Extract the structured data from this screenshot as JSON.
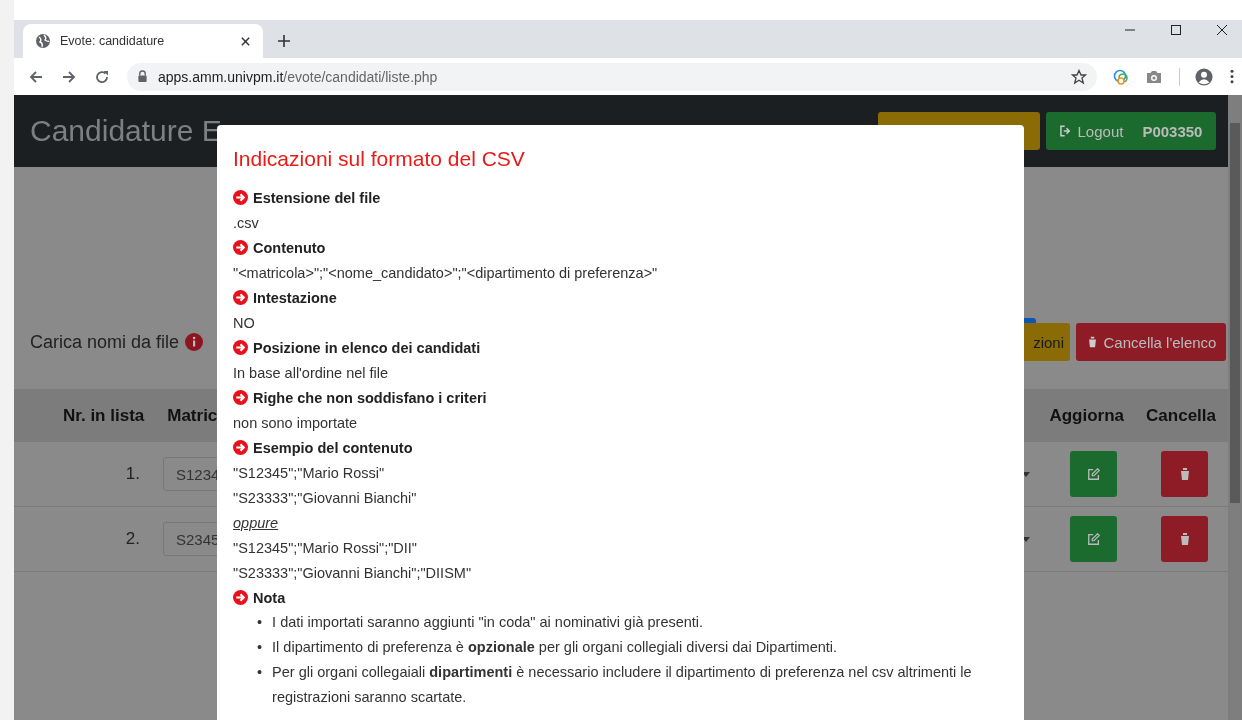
{
  "browser": {
    "tab_title": "Evote: candidature",
    "url_host": "apps.amm.univpm.it",
    "url_path": "/evote/candidati/liste.php"
  },
  "page": {
    "title": "Candidature E",
    "logout_label": "Logout",
    "user": "P003350",
    "upload_label": "Carica nomi da file",
    "instructions_button": "zioni",
    "clear_button": "Cancella l'elenco",
    "table": {
      "columns": [
        "Nr. in lista",
        "Matric",
        "Aggiorna",
        "Cancella"
      ],
      "rows": [
        {
          "number": "1.",
          "matricola": "S1234"
        },
        {
          "number": "2.",
          "matricola": "S2345"
        }
      ]
    }
  },
  "modal": {
    "title": "Indicazioni sul formato del CSV",
    "sections": [
      {
        "heading": "Estensione del file",
        "lines": [
          {
            "kind": "plain",
            "text": ".csv"
          }
        ]
      },
      {
        "heading": "Contenuto",
        "lines": [
          {
            "kind": "plain",
            "text": "\"<matricola>\";\"<nome_candidato>\";\"<dipartimento di preferenza>\""
          }
        ]
      },
      {
        "heading": "Intestazione",
        "lines": [
          {
            "kind": "plain",
            "text": "NO"
          }
        ]
      },
      {
        "heading": "Posizione in elenco dei candidati",
        "lines": [
          {
            "kind": "plain",
            "text": "In base all'ordine nel file"
          }
        ]
      },
      {
        "heading": "Righe che non soddisfano i criteri",
        "lines": [
          {
            "kind": "plain",
            "text": "non sono importate"
          }
        ]
      },
      {
        "heading": "Esempio del contenuto",
        "lines": [
          {
            "kind": "plain",
            "text": "\"S12345\";\"Mario Rossi\""
          },
          {
            "kind": "plain",
            "text": "\"S23333\";\"Giovanni Bianchi\""
          },
          {
            "kind": "alt",
            "text": "oppure"
          },
          {
            "kind": "plain",
            "text": "\"S12345\";\"Mario Rossi\";\"DII\""
          },
          {
            "kind": "plain",
            "text": "\"S23333\";\"Giovanni Bianchi\";\"DIISM\""
          }
        ]
      },
      {
        "heading": "Nota",
        "marker": "•",
        "bullets": [
          "I dati importati saranno aggiunti \"in coda\" ai nominativi già presenti.",
          "Il dipartimento di preferenza è **opzionale** per gli organi collegiali diversi dai Dipartimenti.",
          "Per gli organi collegaiali **dipartimenti** è necessario includere il dipartimento di preferenza nel csv altrimenti le registrazioni saranno scartate."
        ]
      }
    ]
  }
}
